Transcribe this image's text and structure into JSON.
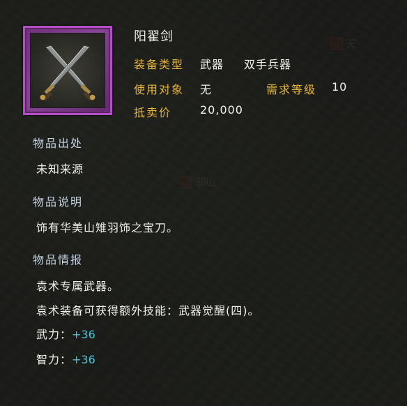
{
  "item": {
    "name": "阳翟剑",
    "type_label": "装备类型",
    "type_value": "武器",
    "type_sub": "双手兵器",
    "user_label": "使用对象",
    "user_value": "无",
    "level_label": "需求等级",
    "level_value": "10",
    "price_label": "抵卖价",
    "price_value": "20,000",
    "icon": "crossed-swords-icon",
    "rarity_color": "#b14fc4"
  },
  "origin": {
    "title": "物品出处",
    "text": "未知来源"
  },
  "description": {
    "title": "物品说明",
    "text": "饰有华美山雉羽饰之宝刀。"
  },
  "info": {
    "title": "物品情报",
    "lines": [
      "袁术专属武器。",
      "袁术装备可获得额外技能：武器觉醒(四)。"
    ],
    "attrs": [
      {
        "name": "武力：",
        "value": "+36"
      },
      {
        "name": "智力：",
        "value": "+36"
      }
    ]
  },
  "background_labels": [
    "天",
    "邪山"
  ],
  "colors": {
    "label": "#e6b43a",
    "section": "#c4d3e2",
    "bonus": "#4ec3d8"
  }
}
